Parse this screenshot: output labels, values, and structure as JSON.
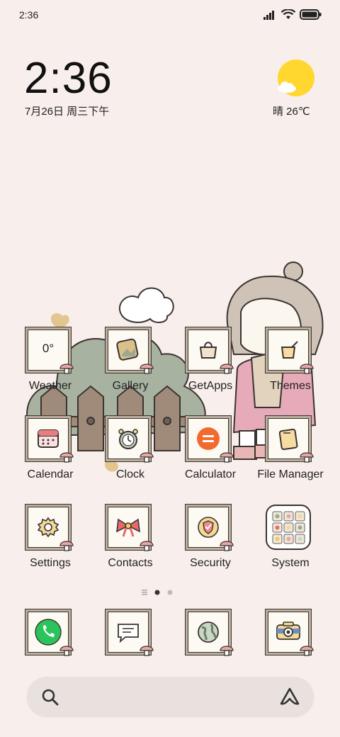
{
  "status": {
    "time": "2:36"
  },
  "clock": {
    "time": "2:36",
    "date": "7月26日 周三下午"
  },
  "weather": {
    "text": "晴 26℃"
  },
  "apps": [
    {
      "label": "Weather",
      "tile_text": "0°",
      "icon": "weather-icon"
    },
    {
      "label": "Gallery",
      "icon": "gallery-icon"
    },
    {
      "label": "GetApps",
      "icon": "getapps-bag-icon"
    },
    {
      "label": "Themes",
      "icon": "themes-icon"
    },
    {
      "label": "Calendar",
      "icon": "calendar-icon"
    },
    {
      "label": "Clock",
      "icon": "alarm-clock-icon"
    },
    {
      "label": "Calculator",
      "icon": "calculator-icon"
    },
    {
      "label": "File Manager",
      "icon": "file-manager-icon"
    },
    {
      "label": "Settings",
      "icon": "gear-icon"
    },
    {
      "label": "Contacts",
      "icon": "bow-icon"
    },
    {
      "label": "Security",
      "icon": "shield-icon"
    },
    {
      "label": "System",
      "icon": "folder-grid-icon"
    }
  ],
  "dock": [
    {
      "icon": "phone-icon"
    },
    {
      "icon": "message-icon"
    },
    {
      "icon": "browser-globe-icon"
    },
    {
      "icon": "camera-icon"
    }
  ],
  "colors": {
    "background": "#f8efec",
    "sun": "#ffd72e",
    "calculator": "#f26a2e",
    "phone": "#2bc45b"
  }
}
